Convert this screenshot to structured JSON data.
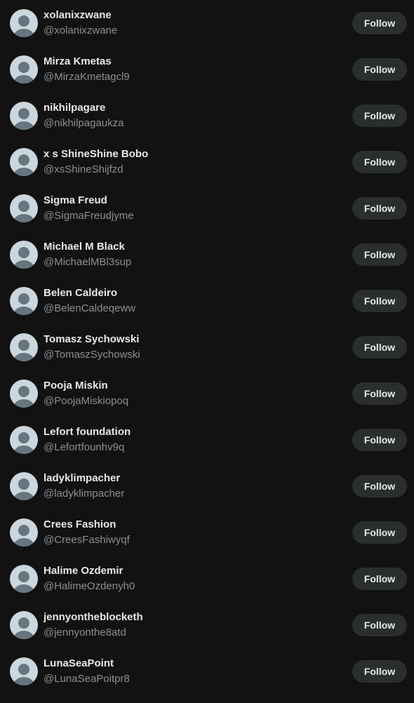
{
  "follow_label": "Follow",
  "accounts": [
    {
      "name": "xolanixzwane",
      "handle": "@xolanixzwane"
    },
    {
      "name": "Mirza Kmetas",
      "handle": "@MirzaKmetagcl9"
    },
    {
      "name": "nikhilpagare",
      "handle": "@nikhilpagaukza"
    },
    {
      "name": "x s ShineShine Bobo",
      "handle": "@xsShineShijfzd"
    },
    {
      "name": "Sigma Freud",
      "handle": "@SigmaFreudjyme"
    },
    {
      "name": "Michael M Black",
      "handle": "@MichaelMBl3sup"
    },
    {
      "name": "Belen Caldeiro",
      "handle": "@BelenCaldeqeww"
    },
    {
      "name": "Tomasz Sychowski",
      "handle": "@TomaszSychowski"
    },
    {
      "name": "Pooja Miskin",
      "handle": "@PoojaMiskiopoq"
    },
    {
      "name": "Lefort foundation",
      "handle": "@Lefortfounhv9q"
    },
    {
      "name": "ladyklimpacher",
      "handle": "@ladyklimpacher"
    },
    {
      "name": "Crees Fashion",
      "handle": "@CreesFashiwyqf"
    },
    {
      "name": "Halime Ozdemir",
      "handle": "@HalimeOzdenyh0"
    },
    {
      "name": "jennyontheblocketh",
      "handle": "@jennyonthe8atd"
    },
    {
      "name": "LunaSeaPoint",
      "handle": "@LunaSeaPoitpr8"
    }
  ],
  "colors": {
    "background": "#121212",
    "name_text": "#e7e9ea",
    "handle_text": "#8b8f94",
    "button_bg": "#2a2e2f",
    "avatar_bg": "#ccd6dd",
    "avatar_figure": "#66757f"
  },
  "icons": {
    "avatar": "default-profile-avatar-icon"
  }
}
